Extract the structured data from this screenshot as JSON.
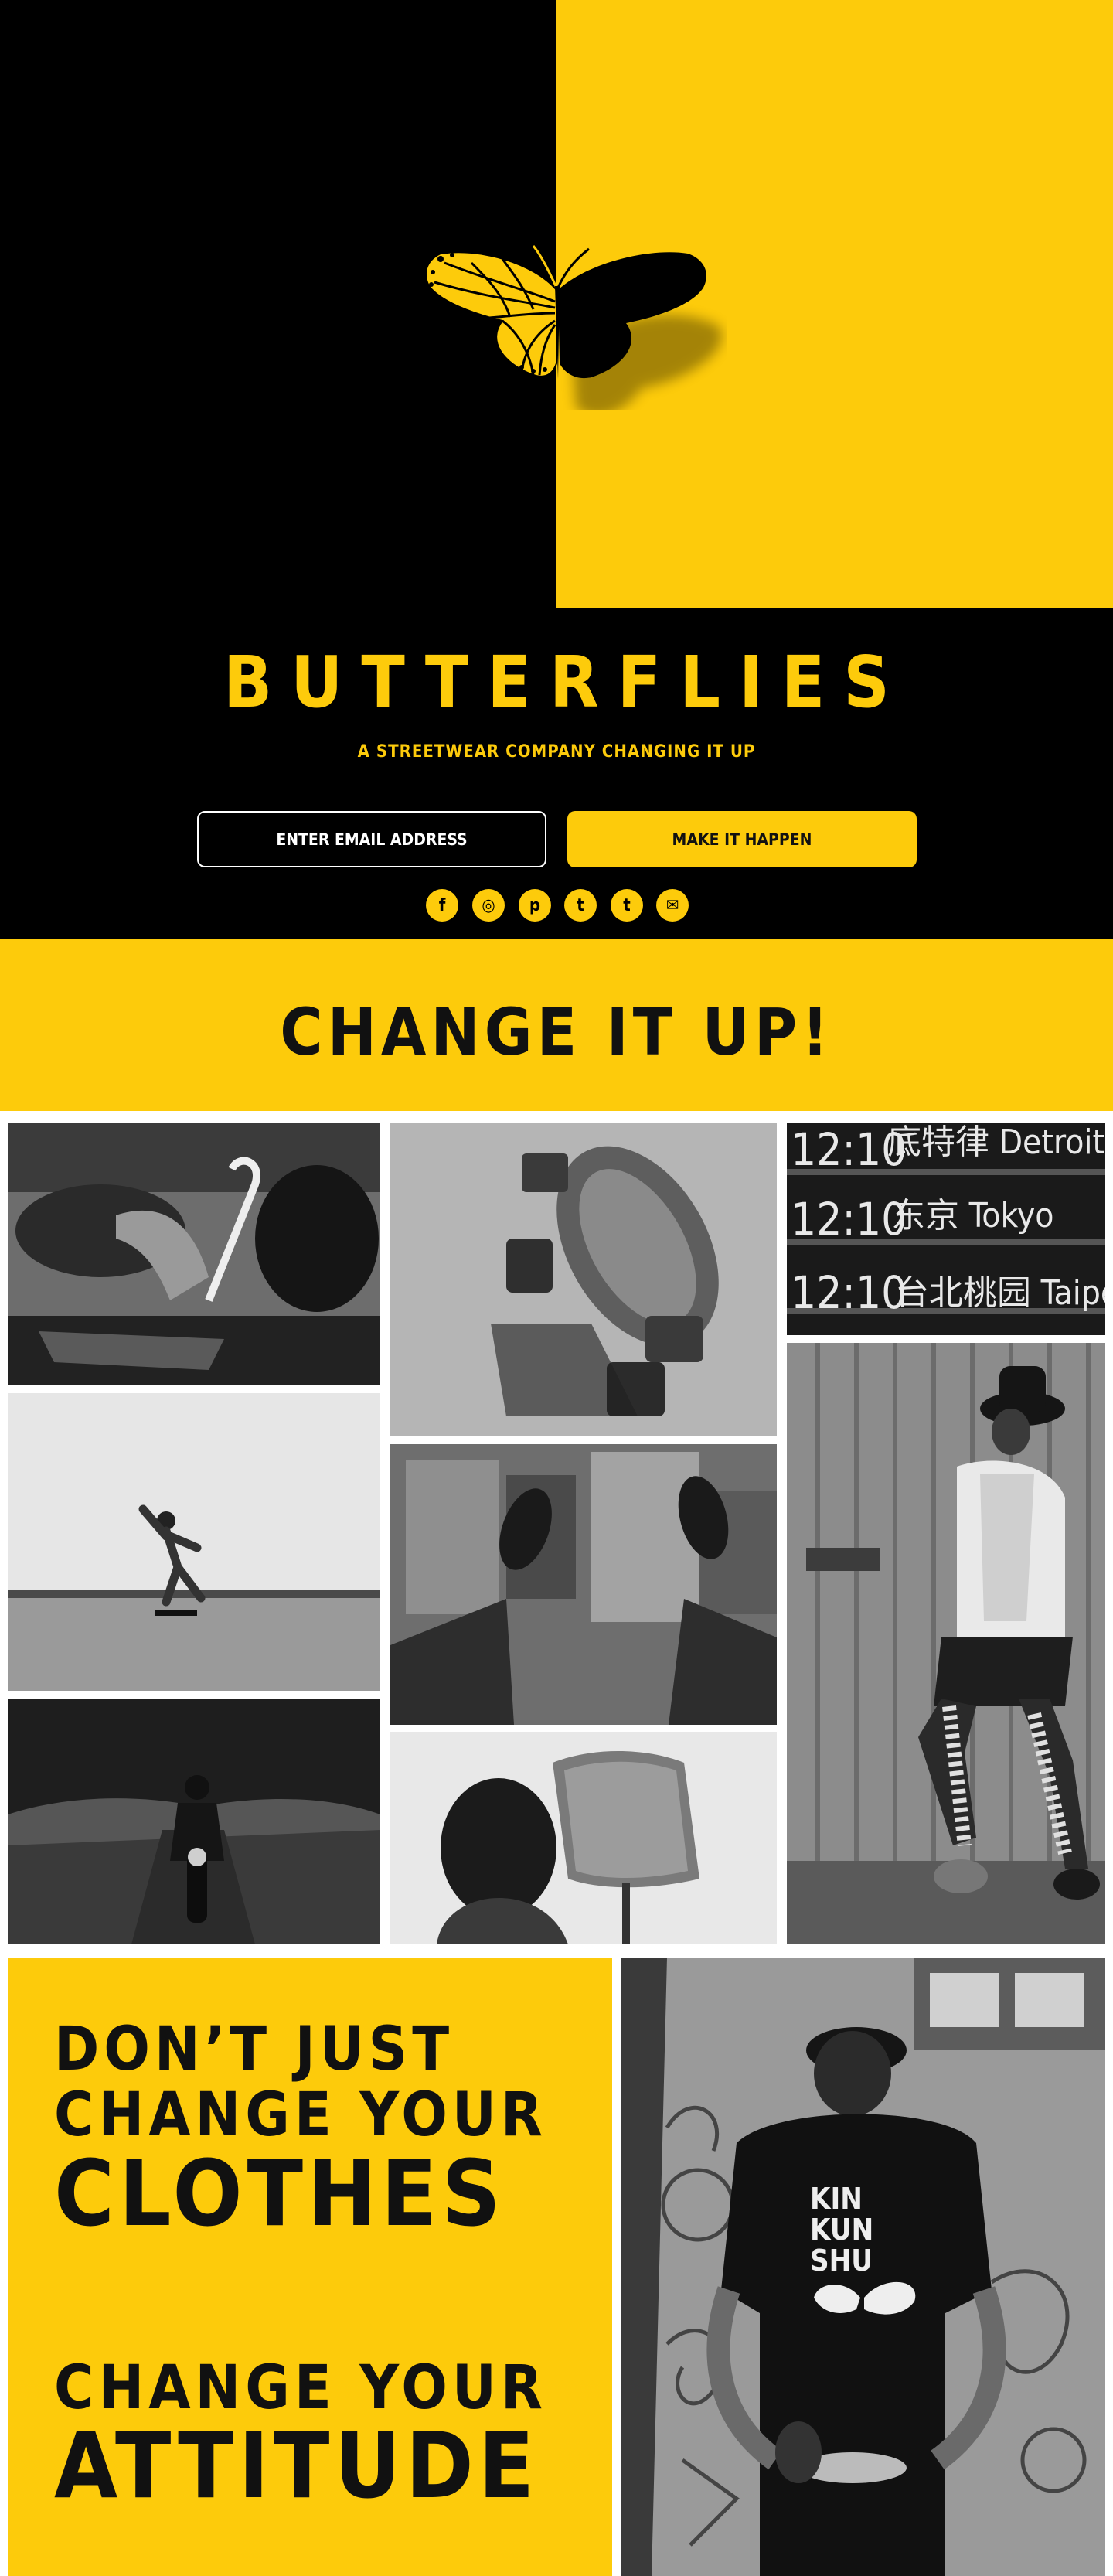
{
  "hero": {
    "brand": "BUTTERFLIES",
    "tagline": "A STREETWEAR COMPANY CHANGING IT UP",
    "email_placeholder": "ENTER EMAIL ADDRESS",
    "cta_label": "MAKE IT HAPPEN",
    "social": [
      {
        "name": "facebook",
        "glyph": "f"
      },
      {
        "name": "instagram",
        "glyph": "◎"
      },
      {
        "name": "pinterest",
        "glyph": "p"
      },
      {
        "name": "twitter",
        "glyph": "t"
      },
      {
        "name": "tumblr",
        "glyph": "t"
      },
      {
        "name": "email",
        "glyph": "✉"
      }
    ]
  },
  "banner": {
    "text": "CHANGE IT UP!"
  },
  "gallery": {
    "board": {
      "time_1": "12:10",
      "city_1": "底特律 Detroit",
      "time_2": "12:10",
      "city_2": "东京 Tokyo",
      "time_3": "12:10",
      "city_3": "台北桃园 Taipei Ta"
    },
    "shirt_text": [
      "KIN",
      "KUN",
      "SHU"
    ]
  },
  "quote": {
    "line1": "DON’T JUST",
    "line2": "CHANGE YOUR",
    "line3": "CLOTHES",
    "line4": "CHANGE YOUR",
    "line5": "ATTITUDE"
  },
  "colors": {
    "accent": "#fdcb0b",
    "dark": "#000000"
  }
}
